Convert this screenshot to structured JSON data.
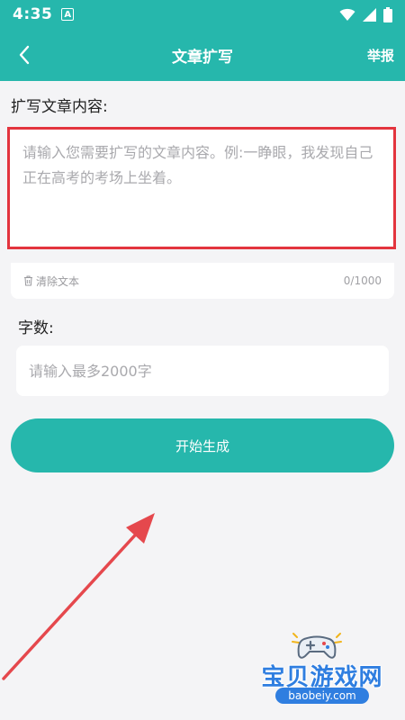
{
  "status_bar": {
    "time": "4:35",
    "notification_letter": "A"
  },
  "app_bar": {
    "title": "文章扩写",
    "report_label": "举报"
  },
  "article_section": {
    "label": "扩写文章内容:",
    "placeholder": "请输入您需要扩写的文章内容。例:一睁眼，我发现自己正在高考的考场上坐着。",
    "value": "",
    "clear_label": "清除文本",
    "counter": "0/1000"
  },
  "word_count_section": {
    "label": "字数:",
    "placeholder": "请输入最多2000字",
    "value": ""
  },
  "start_button": {
    "label": "开始生成"
  },
  "watermark": {
    "brand": "宝贝游戏网",
    "domain": "baobeiy.com"
  },
  "colors": {
    "primary": "#26b7ac",
    "highlight_border": "#e3343e",
    "annotation_arrow": "#e5484d",
    "watermark_blue": "#2f7ee0"
  },
  "icons": {
    "back": "chevron-left-icon",
    "wifi": "wifi-icon",
    "signal": "cell-signal-icon",
    "battery": "battery-icon",
    "clear": "trash-icon",
    "gamepad": "gamepad-icon"
  }
}
